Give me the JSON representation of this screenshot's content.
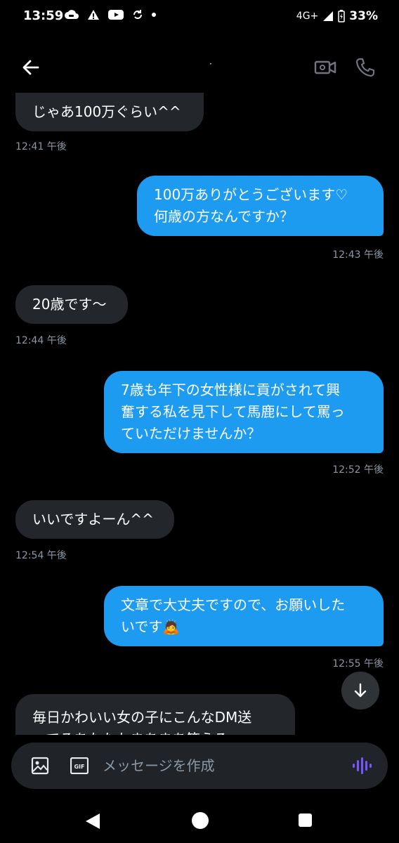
{
  "status_bar": {
    "time": "13:59",
    "network": "4G+",
    "battery": "33%"
  },
  "header": {
    "title": "·"
  },
  "messages": [
    {
      "dir": "in",
      "lines": [
        "じゃあ100万ぐらい^^"
      ],
      "time": "12:41 午後"
    },
    {
      "dir": "out",
      "lines": [
        "100万ありがとうございます♡",
        "何歳の方なんですか？"
      ],
      "time": "12:43 午後"
    },
    {
      "dir": "in",
      "lines": [
        "20歳です〜"
      ],
      "time": "12:44 午後"
    },
    {
      "dir": "out",
      "lines": [
        "7歳も年下の女性様に貢がされて興",
        "奮する私を見下して馬鹿にして罵っ",
        "ていただけませんか？"
      ],
      "time": "12:52 午後"
    },
    {
      "dir": "in",
      "lines": [
        "いいですよーん^^"
      ],
      "time": "12:54 午後"
    },
    {
      "dir": "out",
      "lines": [
        "文章で大丈夫ですので、お願いした",
        "いです🙇"
      ],
      "time": "12:55 午後"
    },
    {
      "dir": "in",
      "lines": [
        "毎日かわいい女の子にこんなDM送",
        "ってるあなたもまあまあ笑える"
      ],
      "time": ""
    }
  ],
  "composer": {
    "placeholder": "メッセージを作成",
    "gif_label": "GIF"
  },
  "colors": {
    "outgoing_bubble": "#1d9bf0",
    "incoming_bubble": "#23272c",
    "timestamp": "#8b98a5",
    "voice_accent": "#7856ff"
  }
}
